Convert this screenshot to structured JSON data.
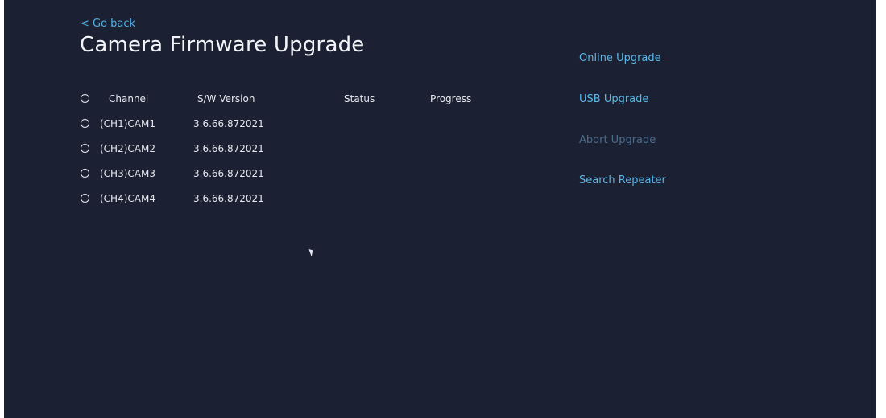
{
  "nav": {
    "back_label": "< Go back"
  },
  "page": {
    "title": "Camera Firmware Upgrade"
  },
  "table": {
    "headers": {
      "channel": "Channel",
      "version": "S/W Version",
      "status": "Status",
      "progress": "Progress"
    },
    "rows": [
      {
        "channel": "(CH1)CAM1",
        "version": "3.6.66.872021"
      },
      {
        "channel": "(CH2)CAM2",
        "version": "3.6.66.872021"
      },
      {
        "channel": "(CH3)CAM3",
        "version": "3.6.66.872021"
      },
      {
        "channel": "(CH4)CAM4",
        "version": "3.6.66.872021"
      }
    ]
  },
  "actions": {
    "online_upgrade": "Online Upgrade",
    "usb_upgrade": "USB Upgrade",
    "abort_upgrade": "Abort Upgrade",
    "search_repeater": "Search Repeater"
  },
  "colors": {
    "background": "#1b2032",
    "accent": "#5cb6e8",
    "disabled": "#4d6c8a",
    "text": "#e6e9ef"
  }
}
